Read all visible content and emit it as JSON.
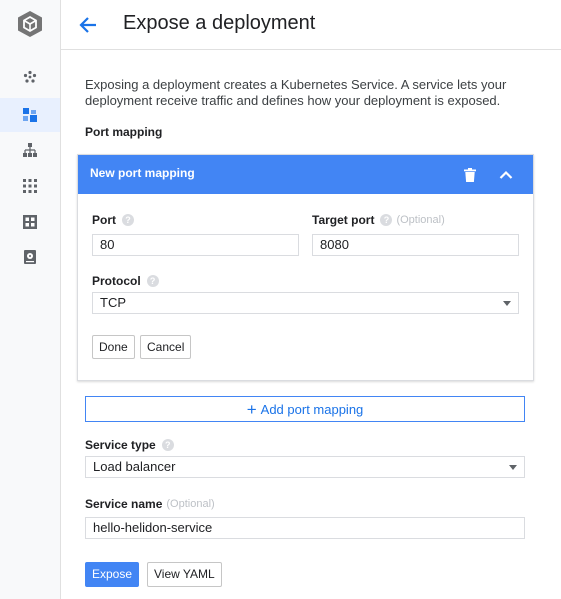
{
  "app": {
    "logo_icon": "cube-logo-icon"
  },
  "sidebar": {
    "items": [
      {
        "icon": "cluster-nodes-icon",
        "active": false
      },
      {
        "icon": "workloads-icon",
        "active": true
      },
      {
        "icon": "services-tree-icon",
        "active": false
      },
      {
        "icon": "apps-grid-icon",
        "active": false
      },
      {
        "icon": "config-icon",
        "active": false
      },
      {
        "icon": "storage-icon",
        "active": false
      }
    ]
  },
  "header": {
    "title": "Expose a deployment",
    "back_icon": "arrow-back-icon"
  },
  "intro_text": "Exposing a deployment creates a Kubernetes Service. A service lets your deployment receive traffic and defines how your deployment is exposed.",
  "port_mapping": {
    "section_label": "Port mapping",
    "card_title": "New port mapping",
    "port_label": "Port",
    "port_value": "80",
    "target_port_label": "Target port",
    "target_port_optional": "(Optional)",
    "target_port_value": "8080",
    "protocol_label": "Protocol",
    "protocol_value": "TCP",
    "done_label": "Done",
    "cancel_label": "Cancel",
    "add_label": "Add port mapping"
  },
  "service": {
    "type_label": "Service type",
    "type_value": "Load balancer",
    "name_label": "Service name",
    "name_optional": "(Optional)",
    "name_value": "hello-helidon-service"
  },
  "actions": {
    "expose_label": "Expose",
    "yaml_label": "View YAML"
  },
  "colors": {
    "accent": "#4285f4",
    "accent_text": "#1a73e8"
  }
}
